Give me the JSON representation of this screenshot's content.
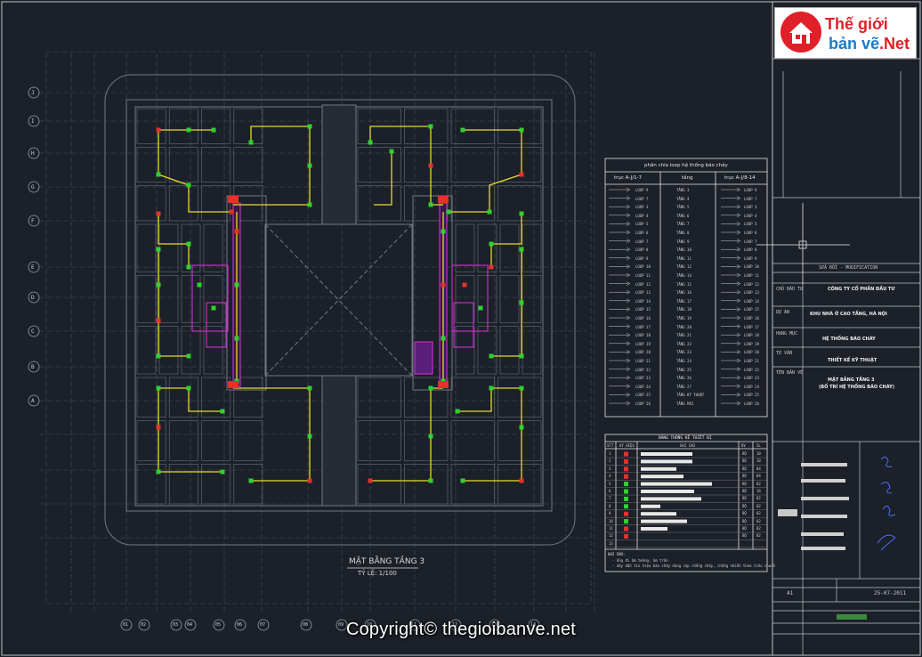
{
  "drawing": {
    "plan_title": "MẶT BẰNG TẦNG 3",
    "plan_scale": "TỶ LỆ: 1/100"
  },
  "logo": {
    "line1": "Thế giới",
    "line2_main": "bản vẽ",
    "line2_suffix": ".Net"
  },
  "watermark": "Copyright© thegioibanve.net",
  "wiring_table": {
    "title": "phân chia loop hệ thống báo cháy",
    "headers": [
      "trục A-J/1-7",
      "tầng",
      "trục A-J/8-14"
    ],
    "rows": [
      [
        "LOOP 9",
        "TẦNG 3",
        "LOOP 9"
      ],
      [
        "LOOP 7",
        "TẦNG 4",
        "LOOP 7"
      ],
      [
        "LOOP 3",
        "TẦNG 5",
        "LOOP 3"
      ],
      [
        "LOOP 4",
        "TẦNG 6",
        "LOOP 4"
      ],
      [
        "LOOP 5",
        "TẦNG 7",
        "LOOP 5"
      ],
      [
        "LOOP 6",
        "TẦNG 8",
        "LOOP 6"
      ],
      [
        "LOOP 7",
        "TẦNG 9",
        "LOOP 7"
      ],
      [
        "LOOP 8",
        "TẦNG 10",
        "LOOP 8"
      ],
      [
        "LOOP 9",
        "TẦNG 11",
        "LOOP 9"
      ],
      [
        "LOOP 10",
        "TẦNG 12",
        "LOOP 10"
      ],
      [
        "LOOP 11",
        "TẦNG 14",
        "LOOP 11"
      ],
      [
        "LOOP 12",
        "TẦNG 15",
        "LOOP 12"
      ],
      [
        "LOOP 13",
        "TẦNG 16",
        "LOOP 13"
      ],
      [
        "LOOP 14",
        "TẦNG 17",
        "LOOP 14"
      ],
      [
        "LOOP 15",
        "TẦNG 18",
        "LOOP 15"
      ],
      [
        "LOOP 16",
        "TẦNG 19",
        "LOOP 16"
      ],
      [
        "LOOP 17",
        "TẦNG 20",
        "LOOP 17"
      ],
      [
        "LOOP 18",
        "TẦNG 21",
        "LOOP 18"
      ],
      [
        "LOOP 19",
        "TẦNG 22",
        "LOOP 19"
      ],
      [
        "LOOP 20",
        "TẦNG 23",
        "LOOP 20"
      ],
      [
        "LOOP 21",
        "TẦNG 24",
        "LOOP 21"
      ],
      [
        "LOOP 22",
        "TẦNG 25",
        "LOOP 22"
      ],
      [
        "LOOP 23",
        "TẦNG 26",
        "LOOP 23"
      ],
      [
        "LOOP 24",
        "TẦNG 27",
        "LOOP 24"
      ],
      [
        "LOOP 25",
        "TẦNG KỸ THUẬT",
        "LOOP 25"
      ],
      [
        "LOOP 26",
        "TẦNG MÁI",
        "LOOP 26"
      ]
    ]
  },
  "device_table": {
    "title": "BẢNG THỐNG KÊ THIẾT BỊ",
    "headers": [
      "STT",
      "KÝ HIỆU",
      "GHI CHÚ",
      "ĐV",
      "SL"
    ],
    "rows": [
      [
        "1",
        "",
        "",
        "BỘ",
        "10"
      ],
      [
        "2",
        "",
        "",
        "BỘ",
        "10"
      ],
      [
        "3",
        "",
        "",
        "BỘ",
        "04"
      ],
      [
        "4",
        "",
        "",
        "BỘ",
        "04"
      ],
      [
        "5",
        "",
        "",
        "BỘ",
        "02"
      ],
      [
        "6",
        "",
        "",
        "BỘ",
        "16"
      ],
      [
        "7",
        "",
        "",
        "BỘ",
        "02"
      ],
      [
        "8",
        "",
        "",
        "BỘ",
        "02"
      ],
      [
        "9",
        "",
        "",
        "BỘ",
        "02"
      ],
      [
        "10",
        "",
        "",
        "BỘ",
        "02"
      ],
      [
        "11",
        "",
        "",
        "BỘ",
        "02"
      ],
      [
        "12",
        "",
        "",
        "BỘ",
        "02"
      ],
      [
        "13",
        "",
        "",
        "",
        ""
      ]
    ],
    "notes_label": "GHI CHÚ:",
    "notes": [
      "- ống đi âm tường, âm trần",
      "- dây dẫn tín hiệu báo cháy dùng cáp chống cháy, chống nhiễu theo tiêu chuẩn"
    ]
  },
  "title_block": {
    "revision": "SỬA ĐỔI - MODIFICATION",
    "owner_label": "CHỦ ĐẦU TƯ",
    "owner": "CÔNG TY CỔ PHẦN ĐẦU TƯ",
    "project_label": "DỰ ÁN",
    "project": "KHU NHÀ Ở CAO TẦNG, HÀ NỘI",
    "item_label": "HẠNG MỤC",
    "item": "HỆ THỐNG BÁO CHÁY",
    "consultant_label": "TƯ VẤN",
    "consultant": "THIẾT KẾ KỸ THUẬT",
    "drawing_label": "TÊN BẢN VẼ",
    "drawing_title_1": "MẶT BẰNG TẦNG 3",
    "drawing_title_2": "(BỐ TRÍ HỆ THỐNG BÁO CHÁY)",
    "sheet_size": "A1",
    "date": "25-07-2011"
  },
  "grid_labels": {
    "left": [
      "J",
      "I",
      "H",
      "G",
      "F",
      "E",
      "D",
      "C",
      "B",
      "A"
    ],
    "bottom": [
      "01",
      "02",
      "03",
      "04",
      "05",
      "06",
      "07",
      "08",
      "09",
      "10",
      "11",
      "12",
      "13",
      "14"
    ]
  },
  "colors": {
    "background": "#1b2029",
    "walls": "#6a6f76",
    "wiring": "#e6dc2a",
    "device_green": "#2fd12f",
    "device_red": "#e8302c",
    "riser_magenta": "#c030c8"
  }
}
